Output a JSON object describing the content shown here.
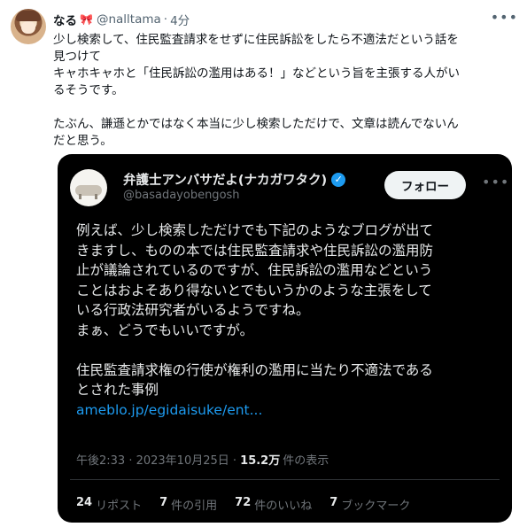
{
  "tweet": {
    "author_name": "なる",
    "author_badge": "🎀",
    "handle": "@nalltama",
    "separator": "·",
    "time": "4分",
    "more_icon": "ellipsis-icon",
    "lines": [
      "少し検索して、住民監査請求をせずに住民訴訟をしたら不適法だという話を",
      "見つけて",
      "キャホキャホと「住民訴訟の濫用はある！」などという旨を主張する人がい",
      "るそうです。",
      "",
      "たぶん、謙遜とかではなく本当に少し検索しただけで、文章は読んでないん",
      "だと思う。"
    ]
  },
  "quote": {
    "author_name": "弁護士アンバサだよ(ナカガワタク)",
    "verified_icon": "verified-badge-icon",
    "handle": "@basadayobengosh",
    "follow_label": "フォロー",
    "more_icon": "ellipsis-icon",
    "lines": [
      "例えば、少し検索しただけでも下記のようなブログが出て",
      "きますし、ものの本では住民監査請求や住民訴訟の濫用防",
      "止が議論されているのですが、住民訴訟の濫用などという",
      "ことはおよそあり得ないとでもいうかのような主張をして",
      "いる行政法研究者がいるようですね。",
      "まぁ、どうでもいいですが。",
      "",
      "住民監査請求権の行使が権利の濫用に当たり不適法である",
      "とされた事例"
    ],
    "link": "ameblo.jp/egidaisuke/ent...",
    "timestamp": "午後2:33 · 2023年10月25日 · ",
    "views_count": "15.2万",
    "views_label": "件の表示",
    "stats": {
      "reposts": {
        "count": "24",
        "label": "リポスト"
      },
      "quotes": {
        "count": "7",
        "label": "件の引用"
      },
      "likes": {
        "count": "72",
        "label": "件のいいね"
      },
      "bookmarks": {
        "count": "7",
        "label": "ブックマーク"
      }
    }
  },
  "colors": {
    "link": "#1d9bf0",
    "verified": "#1d9bf0",
    "quote_bg": "#000000",
    "secondary_text": "#536471"
  }
}
